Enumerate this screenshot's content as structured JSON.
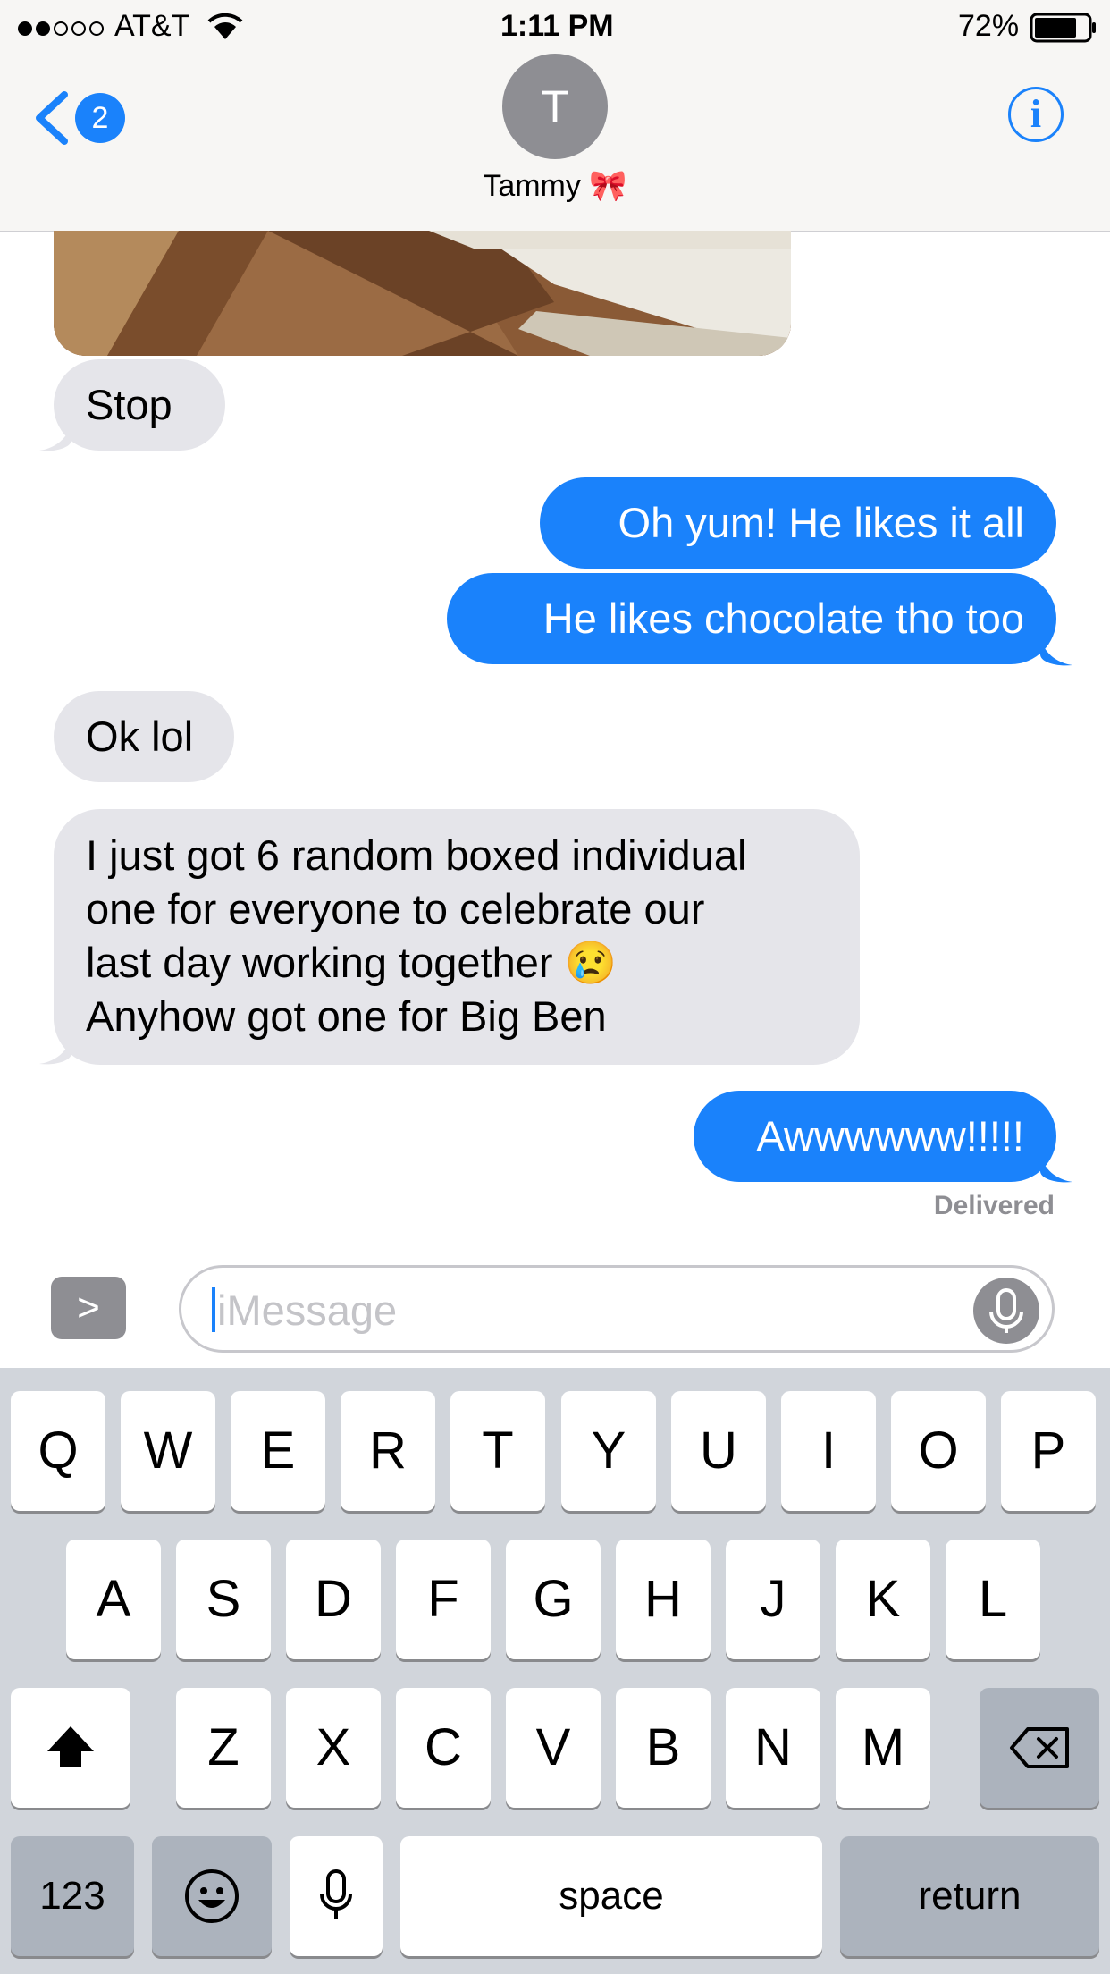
{
  "status_bar": {
    "carrier": "AT&T",
    "time": "1:11 PM",
    "battery": "72%"
  },
  "nav": {
    "back_badge": "2",
    "avatar_initial": "T",
    "contact_name": "Tammy 🎀",
    "info_glyph": "i"
  },
  "messages": [
    {
      "direction": "incoming",
      "text": "Stop"
    },
    {
      "direction": "outgoing",
      "text": "Oh yum! He likes it all"
    },
    {
      "direction": "outgoing",
      "text": "He likes chocolate tho too"
    },
    {
      "direction": "incoming",
      "text": "Ok lol"
    },
    {
      "direction": "incoming",
      "lines": [
        "I just got 6 random boxed individual",
        "one for everyone to celebrate our",
        "last day working together 😢",
        "Anyhow got one for Big Ben"
      ]
    },
    {
      "direction": "outgoing",
      "text": "Awwwwww!!!!!"
    }
  ],
  "delivered_label": "Delivered",
  "input": {
    "placeholder": "iMessage",
    "expand_glyph": ">"
  },
  "keyboard": {
    "row1": [
      "Q",
      "W",
      "E",
      "R",
      "T",
      "Y",
      "U",
      "I",
      "O",
      "P"
    ],
    "row2": [
      "A",
      "S",
      "D",
      "F",
      "G",
      "H",
      "J",
      "K",
      "L"
    ],
    "row3": [
      "Z",
      "X",
      "C",
      "V",
      "B",
      "N",
      "M"
    ],
    "numbers_label": "123",
    "space_label": "space",
    "return_label": "return"
  },
  "colors": {
    "accent": "#1a82fb",
    "incoming_bubble": "#e5e5ea",
    "keyboard_bg": "#d1d5db"
  },
  "icons": [
    "wifi-icon",
    "battery-icon",
    "back-chevron-icon",
    "info-icon",
    "expand-icon",
    "mic-icon",
    "shift-icon",
    "delete-icon",
    "emoji-icon",
    "dictation-icon"
  ]
}
